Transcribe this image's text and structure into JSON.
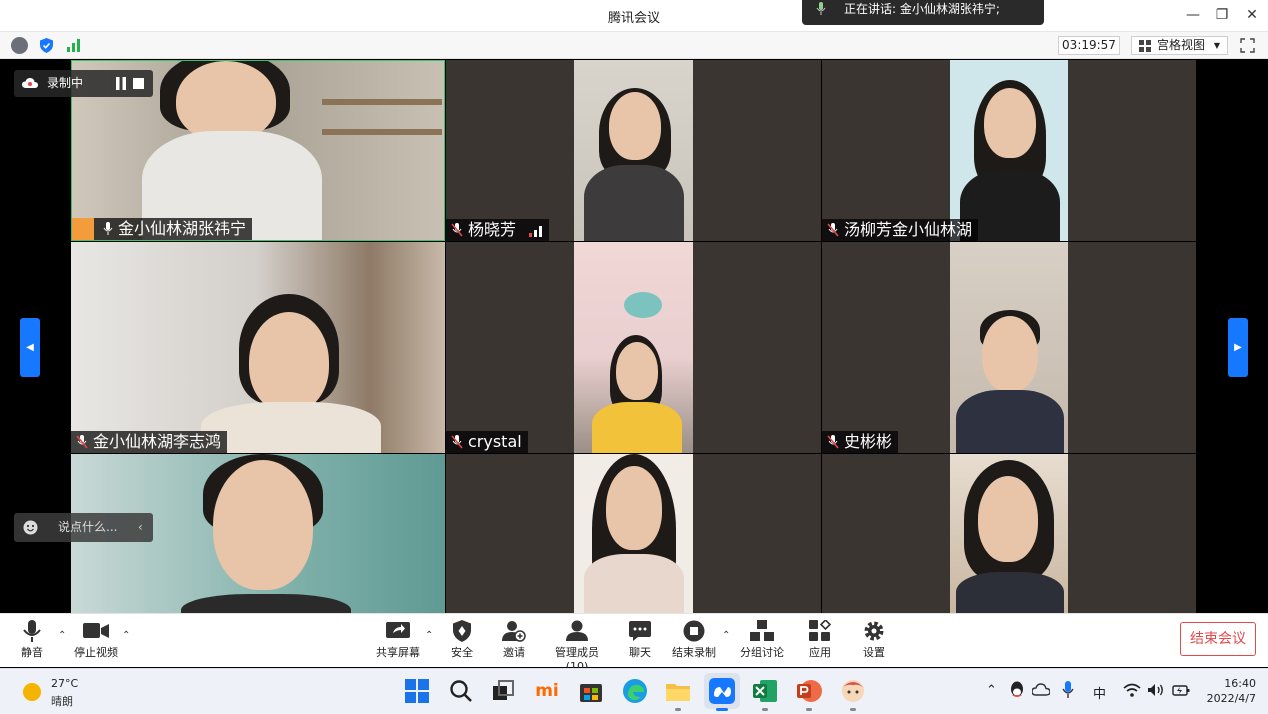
{
  "window": {
    "title": "腾讯会议"
  },
  "speaking": {
    "text": "正在讲话: 金小仙林湖张祎宁;"
  },
  "infobar": {
    "timer": "03:19:57",
    "view_label": "宫格视图"
  },
  "recording": {
    "label": "录制中"
  },
  "chat": {
    "placeholder": "说点什么..."
  },
  "participants": [
    {
      "name": "金小仙林湖张祎宁",
      "host": true
    },
    {
      "name": "杨晓芳"
    },
    {
      "name": "汤柳芳金小仙林湖"
    },
    {
      "name": "金小仙林湖李志鸿"
    },
    {
      "name": "crystal"
    },
    {
      "name": "史彬彬"
    }
  ],
  "toolbar": {
    "mute": "静音",
    "stop_video": "停止视频",
    "share": "共享屏幕",
    "security": "安全",
    "invite": "邀请",
    "members": "管理成员(10)",
    "chat": "聊天",
    "end_record": "结束录制",
    "breakout": "分组讨论",
    "apps": "应用",
    "settings": "设置",
    "end_meeting": "结束会议"
  },
  "taskbar": {
    "temperature": "27°C",
    "weather": "晴朗",
    "ime": "中",
    "time": "16:40",
    "date": "2022/4/7"
  },
  "colors": {
    "accent": "#1677ff",
    "danger": "#e24a4a",
    "host_badge": "#f39c3c"
  }
}
